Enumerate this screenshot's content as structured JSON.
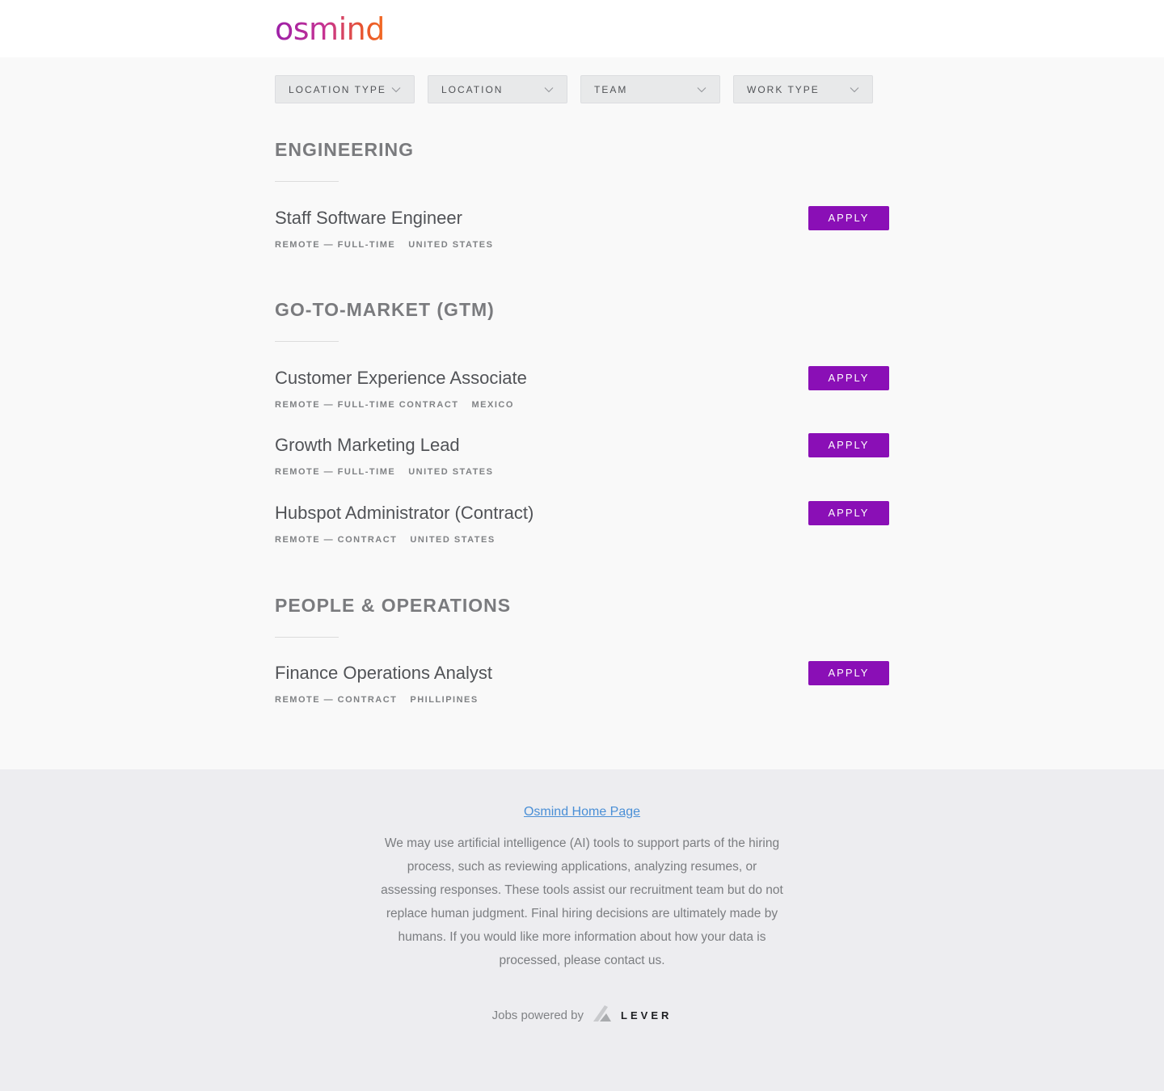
{
  "brand": {
    "logo_text": "osmind"
  },
  "filters": [
    {
      "label": "LOCATION TYPE"
    },
    {
      "label": "LOCATION"
    },
    {
      "label": "TEAM"
    },
    {
      "label": "WORK TYPE"
    }
  ],
  "groups": [
    {
      "title": "ENGINEERING",
      "postings": [
        {
          "title": "Staff Software Engineer",
          "workplace": "REMOTE — FULL-TIME",
          "location": "UNITED STATES",
          "apply": "APPLY"
        }
      ]
    },
    {
      "title": "GO-TO-MARKET (GTM)",
      "postings": [
        {
          "title": "Customer Experience Associate",
          "workplace": "REMOTE — FULL-TIME CONTRACT",
          "location": "MEXICO",
          "apply": "APPLY"
        },
        {
          "title": "Growth Marketing Lead",
          "workplace": "REMOTE — FULL-TIME",
          "location": "UNITED STATES",
          "apply": "APPLY"
        },
        {
          "title": "Hubspot Administrator (Contract)",
          "workplace": "REMOTE — CONTRACT",
          "location": "UNITED STATES",
          "apply": "APPLY"
        }
      ]
    },
    {
      "title": "PEOPLE & OPERATIONS",
      "postings": [
        {
          "title": "Finance Operations Analyst",
          "workplace": "REMOTE — CONTRACT",
          "location": "PHILLIPINES",
          "apply": "APPLY"
        }
      ]
    }
  ],
  "footer": {
    "home_link": "Osmind Home Page",
    "ai_note": "We may use artificial intelligence (AI) tools to support parts of the hiring process, such as reviewing applications, analyzing resumes, or assessing responses. These tools assist our recruitment team but do not replace human judgment. Final hiring decisions are ultimately made by humans. If you would like more information about how your data is processed, please contact us.",
    "powered_by": "Jobs powered by",
    "lever_wordmark": "LEVER"
  },
  "colors": {
    "apply_button": "#8a0fb6",
    "link": "#4a8fd6",
    "logo_gradient": [
      "#9b1fa8",
      "#f26a22"
    ]
  },
  "icons": {
    "filter_chevron": "chevron-down-icon",
    "lever_logo": "lever-logo-icon"
  }
}
